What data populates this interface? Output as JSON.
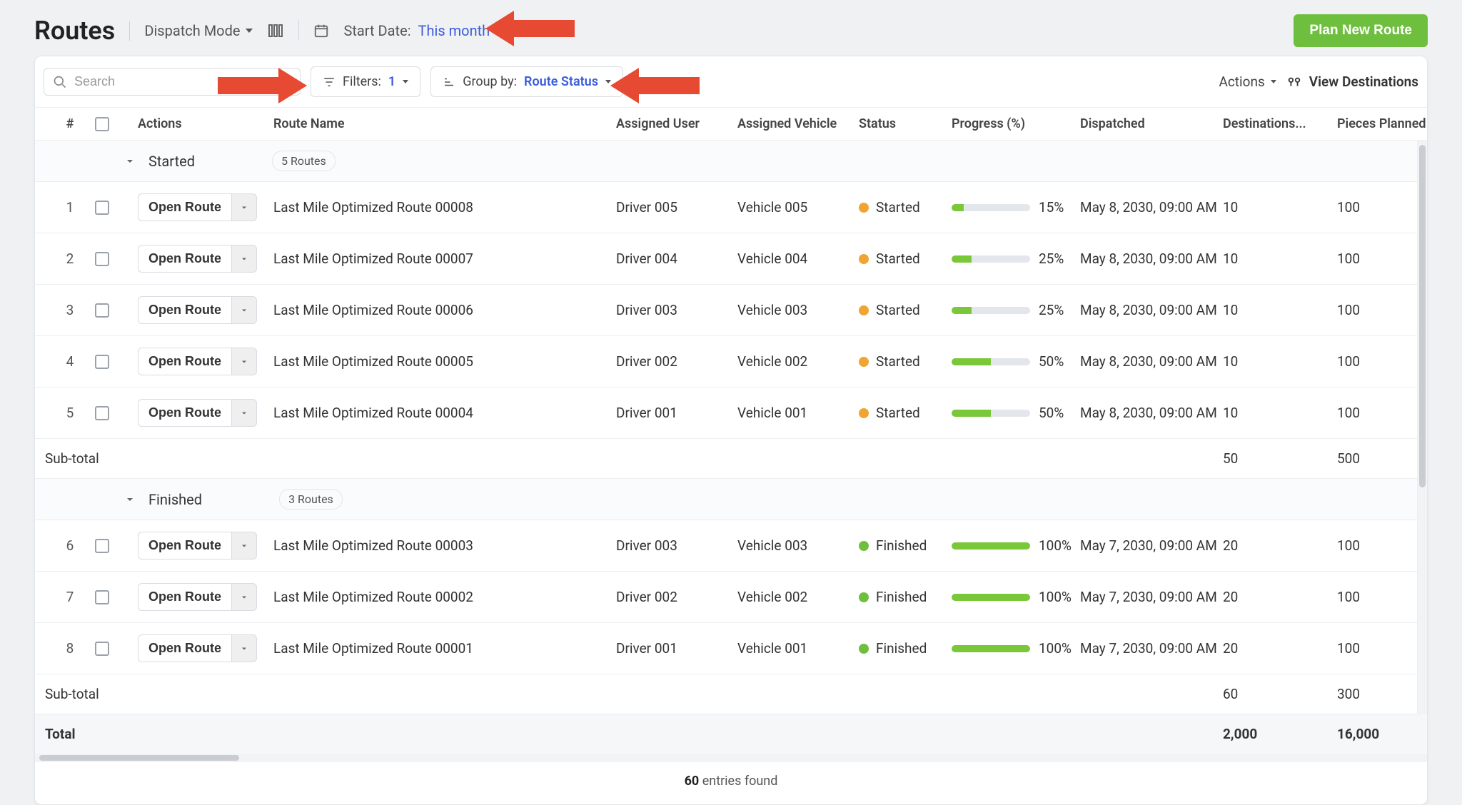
{
  "header": {
    "title": "Routes",
    "dispatch_mode_label": "Dispatch Mode",
    "start_date_label": "Start Date:",
    "start_date_value": "This month",
    "plan_button": "Plan New Route"
  },
  "toolbar": {
    "search_placeholder": "Search",
    "filters_label": "Filters:",
    "filters_count": "1",
    "groupby_label": "Group by:",
    "groupby_value": "Route Status",
    "actions_label": "Actions",
    "view_destinations_label": "View Destinations"
  },
  "columns": {
    "num": "#",
    "actions": "Actions",
    "route_name": "Route Name",
    "assigned_user": "Assigned User",
    "assigned_vehicle": "Assigned Vehicle",
    "status": "Status",
    "progress": "Progress (%)",
    "dispatched": "Dispatched",
    "destinations": "Destinations...",
    "pieces_planned": "Pieces Planned"
  },
  "groups": [
    {
      "name": "Started",
      "count_label": "5 Routes",
      "rows": [
        {
          "idx": "1",
          "open": "Open Route",
          "name": "Last Mile Optimized Route 00008",
          "user": "Driver 005",
          "vehicle": "Vehicle 005",
          "status": "Started",
          "status_color": "orange",
          "progress": 15,
          "progress_label": "15%",
          "dispatched": "May 8, 2030, 09:00 AM",
          "dest": "10",
          "pieces": "100"
        },
        {
          "idx": "2",
          "open": "Open Route",
          "name": "Last Mile Optimized Route 00007",
          "user": "Driver 004",
          "vehicle": "Vehicle 004",
          "status": "Started",
          "status_color": "orange",
          "progress": 25,
          "progress_label": "25%",
          "dispatched": "May 8, 2030, 09:00 AM",
          "dest": "10",
          "pieces": "100"
        },
        {
          "idx": "3",
          "open": "Open Route",
          "name": "Last Mile Optimized Route 00006",
          "user": "Driver 003",
          "vehicle": "Vehicle 003",
          "status": "Started",
          "status_color": "orange",
          "progress": 25,
          "progress_label": "25%",
          "dispatched": "May 8, 2030, 09:00 AM",
          "dest": "10",
          "pieces": "100"
        },
        {
          "idx": "4",
          "open": "Open Route",
          "name": "Last Mile Optimized Route 00005",
          "user": "Driver 002",
          "vehicle": "Vehicle 002",
          "status": "Started",
          "status_color": "orange",
          "progress": 50,
          "progress_label": "50%",
          "dispatched": "May 8, 2030, 09:00 AM",
          "dest": "10",
          "pieces": "100"
        },
        {
          "idx": "5",
          "open": "Open Route",
          "name": "Last Mile Optimized Route 00004",
          "user": "Driver 001",
          "vehicle": "Vehicle 001",
          "status": "Started",
          "status_color": "orange",
          "progress": 50,
          "progress_label": "50%",
          "dispatched": "May 8, 2030, 09:00 AM",
          "dest": "10",
          "pieces": "100"
        }
      ],
      "subtotal_label": "Sub-total",
      "subtotal_dest": "50",
      "subtotal_pieces": "500"
    },
    {
      "name": "Finished",
      "count_label": "3 Routes",
      "rows": [
        {
          "idx": "6",
          "open": "Open Route",
          "name": "Last Mile Optimized Route 00003",
          "user": "Driver 003",
          "vehicle": "Vehicle 003",
          "status": "Finished",
          "status_color": "green",
          "progress": 100,
          "progress_label": "100%",
          "dispatched": "May 7, 2030, 09:00 AM",
          "dest": "20",
          "pieces": "100"
        },
        {
          "idx": "7",
          "open": "Open Route",
          "name": "Last Mile Optimized Route 00002",
          "user": "Driver 002",
          "vehicle": "Vehicle 002",
          "status": "Finished",
          "status_color": "green",
          "progress": 100,
          "progress_label": "100%",
          "dispatched": "May 7, 2030, 09:00 AM",
          "dest": "20",
          "pieces": "100"
        },
        {
          "idx": "8",
          "open": "Open Route",
          "name": "Last Mile Optimized Route 00001",
          "user": "Driver 001",
          "vehicle": "Vehicle 001",
          "status": "Finished",
          "status_color": "green",
          "progress": 100,
          "progress_label": "100%",
          "dispatched": "May 7, 2030, 09:00 AM",
          "dest": "20",
          "pieces": "100"
        }
      ],
      "subtotal_label": "Sub-total",
      "subtotal_dest": "60",
      "subtotal_pieces": "300"
    }
  ],
  "total": {
    "label": "Total",
    "dest": "2,000",
    "pieces": "16,000"
  },
  "footer": {
    "entries_count": "60",
    "entries_text": "entries found"
  }
}
